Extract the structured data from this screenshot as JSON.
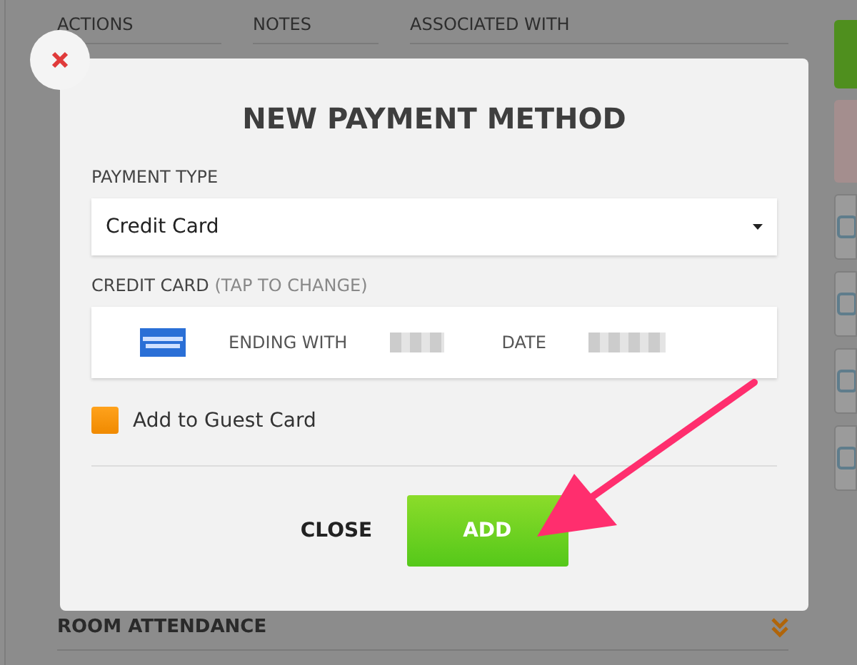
{
  "background": {
    "columns": [
      "ACTIONS",
      "NOTES",
      "ASSOCIATED WITH"
    ],
    "section": "ROOM ATTENDANCE"
  },
  "dialog": {
    "title": "NEW PAYMENT METHOD",
    "payment_type": {
      "label": "PAYMENT TYPE",
      "value": "Credit Card"
    },
    "credit_card": {
      "label": "CREDIT CARD",
      "hint": "(TAP TO CHANGE)",
      "ending_label": "ENDING WITH",
      "date_label": "DATE"
    },
    "guest_card": {
      "label": "Add to Guest Card",
      "checked": false
    },
    "buttons": [
      {
        "label": "CLOSE",
        "kind": "plain"
      },
      {
        "label": "ADD",
        "kind": "primary"
      }
    ]
  }
}
